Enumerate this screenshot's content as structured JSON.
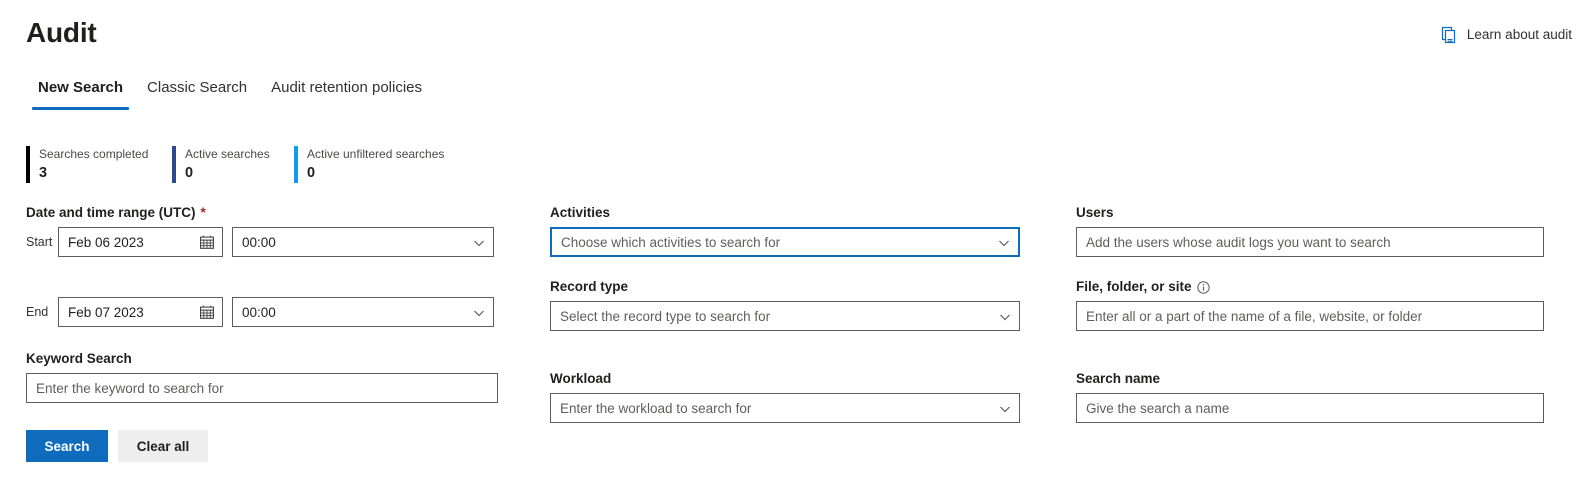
{
  "header": {
    "title": "Audit",
    "learn_link_label": "Learn about audit",
    "learn_link_icon": "pages-icon"
  },
  "tabs": [
    {
      "label": "New Search",
      "active": true
    },
    {
      "label": "Classic Search",
      "active": false
    },
    {
      "label": "Audit retention policies",
      "active": false
    }
  ],
  "stats": [
    {
      "label": "Searches completed",
      "value": "3",
      "color": "#000000"
    },
    {
      "label": "Active searches",
      "value": "0",
      "color": "#2b4b8f"
    },
    {
      "label": "Active unfiltered searches",
      "value": "0",
      "color": "#0f9bf0"
    }
  ],
  "form": {
    "date_range": {
      "label": "Date and time range (UTC)",
      "required_marker": "*",
      "start": {
        "side_label": "Start",
        "date_value": "Feb 06 2023",
        "time_value": "00:00",
        "date_icon": "calendar-icon",
        "time_icon": "chevron-down-icon"
      },
      "end": {
        "side_label": "End",
        "date_value": "Feb 07 2023",
        "time_value": "00:00",
        "date_icon": "calendar-icon",
        "time_icon": "chevron-down-icon"
      }
    },
    "keyword_search": {
      "label": "Keyword Search",
      "placeholder": "Enter the keyword to search for",
      "value": ""
    },
    "activities": {
      "label": "Activities",
      "placeholder": "Choose which activities to search for",
      "value": "",
      "icon": "chevron-down-icon",
      "focused": true
    },
    "record_type": {
      "label": "Record type",
      "placeholder": "Select the record type to search for",
      "value": "",
      "icon": "chevron-down-icon"
    },
    "workload": {
      "label": "Workload",
      "placeholder": "Enter the workload to search for",
      "value": "",
      "icon": "chevron-down-icon"
    },
    "users": {
      "label": "Users",
      "placeholder": "Add the users whose audit logs you want to search",
      "value": ""
    },
    "file_folder_site": {
      "label": "File, folder, or site",
      "info_icon": "info-icon",
      "placeholder": "Enter all or a part of the name of a file, website, or folder",
      "value": ""
    },
    "search_name": {
      "label": "Search name",
      "placeholder": "Give the search a name",
      "value": ""
    }
  },
  "actions": {
    "search_label": "Search",
    "clear_all_label": "Clear all"
  },
  "colors": {
    "accent": "#0f6cbd",
    "required": "#a4262c",
    "border": "#605e5c",
    "secondary_button_bg": "#eeeeee"
  }
}
